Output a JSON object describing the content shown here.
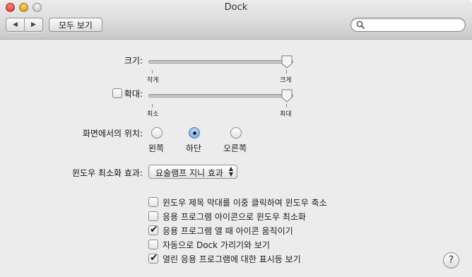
{
  "window": {
    "title": "Dock"
  },
  "toolbar": {
    "back_icon": "left-triangle",
    "forward_icon": "right-triangle",
    "back_glyph": "◀",
    "forward_glyph": "▶",
    "show_all_label": "모두 보기",
    "search": {
      "value": "",
      "placeholder": ""
    }
  },
  "size": {
    "label": "크기:",
    "min_label": "작게",
    "max_label": "크게",
    "value_fraction": 1.0
  },
  "magnification": {
    "label": "확대:",
    "checked": false,
    "min_label": "최소",
    "max_label": "최대",
    "value_fraction": 1.0
  },
  "position": {
    "label": "화면에서의 위치:",
    "options": [
      {
        "label": "왼쪽",
        "selected": false
      },
      {
        "label": "하단",
        "selected": true
      },
      {
        "label": "오른쪽",
        "selected": false
      }
    ]
  },
  "minimize_effect": {
    "label": "윈도우 최소화 효과:",
    "selected": "요술램프 지니 효과"
  },
  "options": [
    {
      "label": "윈도우 제목 막대를 이중 클릭하여 윈도우 축소",
      "checked": false
    },
    {
      "label": "응용 프로그램 아이콘으로 윈도우 최소화",
      "checked": false
    },
    {
      "label": "응용 프로그램 열 때 아이콘 움직이기",
      "checked": true
    },
    {
      "label": "자동으로 Dock 가리기와 보기",
      "checked": false
    },
    {
      "label": "열린 응용 프로그램에 대한 표시등 보기",
      "checked": true
    }
  ],
  "help": {
    "glyph": "?"
  },
  "colors": {
    "accent": "#7fb0ec",
    "window_bg": "#ececec"
  }
}
